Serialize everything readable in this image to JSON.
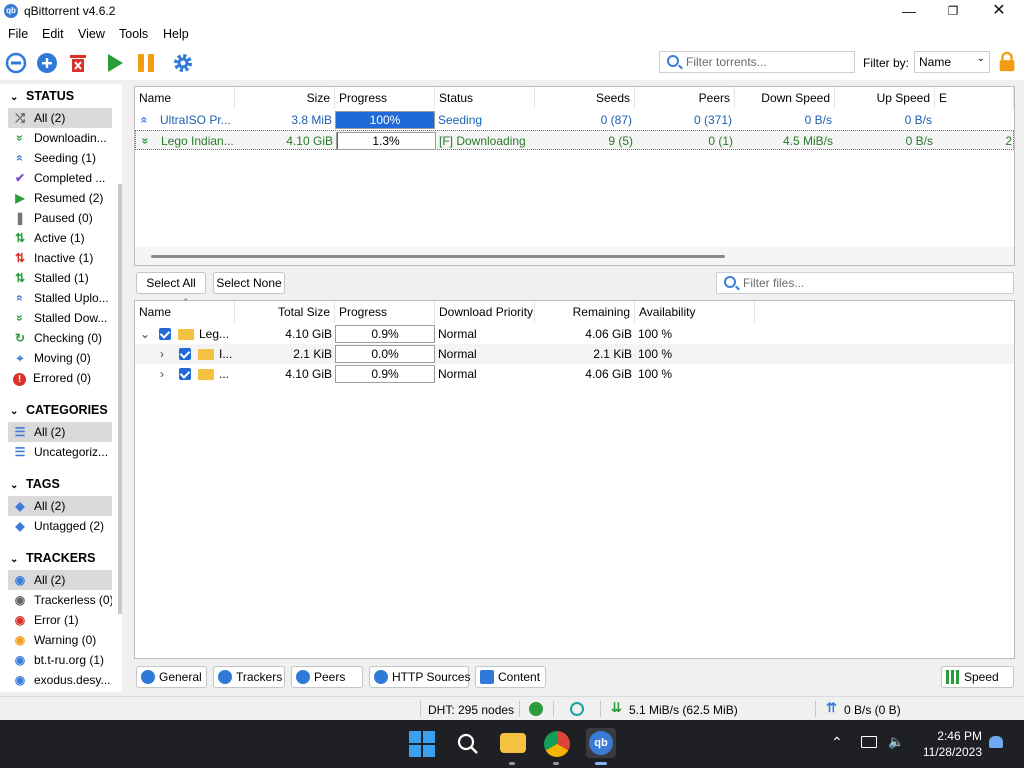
{
  "window": {
    "title": "qBittorrent v4.6.2"
  },
  "menu": [
    "File",
    "Edit",
    "View",
    "Tools",
    "Help"
  ],
  "toolbar": {
    "filter_torrents_placeholder": "Filter torrents...",
    "filter_by_label": "Filter by:",
    "filter_by_value": "Name"
  },
  "sidebar": {
    "status_title": "STATUS",
    "status_items": [
      {
        "label": "All (2)",
        "icon": "shuffle-icon",
        "color": "#555555"
      },
      {
        "label": "Downloadin...",
        "icon": "download-icon",
        "color": "#2a9d3a"
      },
      {
        "label": "Seeding (1)",
        "icon": "upload-icon",
        "color": "#3b7dd8"
      },
      {
        "label": "Completed ...",
        "icon": "checkmark-icon",
        "color": "#7a4fc9"
      },
      {
        "label": "Resumed (2)",
        "icon": "play-icon",
        "color": "#2a9d3a"
      },
      {
        "label": "Paused (0)",
        "icon": "pause-icon",
        "color": "#777777"
      },
      {
        "label": "Active (1)",
        "icon": "active-arrows-icon",
        "color": "#2a9d3a"
      },
      {
        "label": "Inactive (1)",
        "icon": "inactive-arrows-icon",
        "color": "#d9302a"
      },
      {
        "label": "Stalled (1)",
        "icon": "stalled-arrows-icon",
        "color": "#2a9d3a"
      },
      {
        "label": "Stalled Uplo...",
        "icon": "stalled-upload-icon",
        "color": "#3b7dd8"
      },
      {
        "label": "Stalled Dow...",
        "icon": "stalled-download-icon",
        "color": "#2a9d3a"
      },
      {
        "label": "Checking (0)",
        "icon": "checking-icon",
        "color": "#2a9d3a"
      },
      {
        "label": "Moving (0)",
        "icon": "moving-icon",
        "color": "#3b7dd8"
      },
      {
        "label": "Errored (0)",
        "icon": "error-icon",
        "color": "#d9302a"
      }
    ],
    "categories_title": "CATEGORIES",
    "category_items": [
      {
        "label": "All (2)",
        "icon": "list-icon"
      },
      {
        "label": "Uncategoriz...",
        "icon": "list-icon"
      }
    ],
    "tags_title": "TAGS",
    "tag_items": [
      {
        "label": "All (2)",
        "icon": "tag-icon"
      },
      {
        "label": "Untagged (2)",
        "icon": "tag-icon"
      }
    ],
    "trackers_title": "TRACKERS",
    "tracker_items": [
      {
        "label": "All (2)",
        "icon": "pin-icon",
        "color": "#3b7dd8"
      },
      {
        "label": "Trackerless (0)",
        "icon": "pin-icon",
        "color": "#666666"
      },
      {
        "label": "Error (1)",
        "icon": "pin-icon",
        "color": "#d9302a"
      },
      {
        "label": "Warning (0)",
        "icon": "pin-icon",
        "color": "#f0a020"
      },
      {
        "label": "bt.t-ru.org (1)",
        "icon": "pin-icon",
        "color": "#3b7dd8"
      },
      {
        "label": "exodus.desy...",
        "icon": "pin-icon",
        "color": "#3b7dd8"
      }
    ]
  },
  "torrents": {
    "columns": [
      "Name",
      "Size",
      "Progress",
      "Status",
      "Seeds",
      "Peers",
      "Down Speed",
      "Up Speed",
      "E"
    ],
    "rows": [
      {
        "name": "UltraISO Pr...",
        "size": "3.8 MiB",
        "progress": "100%",
        "progress_value": 1.0,
        "status": "Seeding",
        "seeds": "0 (87)",
        "peers": "0 (371)",
        "down": "0 B/s",
        "up": "0 B/s",
        "eta": ""
      },
      {
        "name": "Lego Indian...",
        "size": "4.10 GiB",
        "progress": "1.3%",
        "progress_value": 0.013,
        "status": "[F] Downloading",
        "seeds": "9 (5)",
        "peers": "0 (1)",
        "down": "4.5 MiB/s",
        "up": "0 B/s",
        "eta": "2"
      }
    ]
  },
  "content": {
    "select_all": "Select All",
    "select_none": "Select None",
    "filter_files_placeholder": "Filter files...",
    "columns": [
      "Name",
      "Total Size",
      "Progress",
      "Download Priority",
      "Remaining",
      "Availability"
    ],
    "rows": [
      {
        "name": "Leg...",
        "size": "4.10 GiB",
        "progress": "0.9%",
        "priority": "Normal",
        "remaining": "4.06 GiB",
        "availability": "100 %",
        "expander": "⌄"
      },
      {
        "name": "I...",
        "size": "2.1 KiB",
        "progress": "0.0%",
        "priority": "Normal",
        "remaining": "2.1 KiB",
        "availability": "100 %",
        "expander": "›"
      },
      {
        "name": "...",
        "size": "4.10 GiB",
        "progress": "0.9%",
        "priority": "Normal",
        "remaining": "4.06 GiB",
        "availability": "100 %",
        "expander": "›"
      }
    ]
  },
  "tabs": [
    "General",
    "Trackers",
    "Peers",
    "HTTP Sources",
    "Content"
  ],
  "speed_button": "Speed",
  "statusbar": {
    "dht": "DHT: 295 nodes",
    "download": "5.1 MiB/s (62.5 MiB)",
    "upload": "0 B/s (0 B)"
  },
  "taskbar": {
    "time": "2:46 PM",
    "date": "11/28/2023"
  }
}
